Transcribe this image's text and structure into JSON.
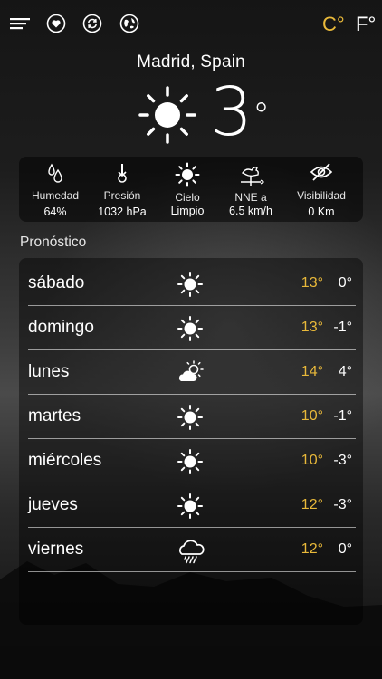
{
  "topbar": {
    "icons": [
      "menu-icon",
      "favorites-icon",
      "refresh-icon",
      "globe-icon"
    ],
    "units": {
      "celsius": "C°",
      "fahrenheit": "F°",
      "active": "celsius"
    },
    "accent_color": "#e9b93a"
  },
  "current": {
    "city": "Madrid, Spain",
    "temperature": "3",
    "degree_symbol": "°",
    "condition_icon": "sun-icon"
  },
  "stats": [
    {
      "icon": "humidity-icon",
      "label": "Humedad",
      "value": "64%"
    },
    {
      "icon": "pressure-icon",
      "label": "Presión",
      "value": "1032 hPa"
    },
    {
      "icon": "sun-icon",
      "label": "Cielo",
      "value": "Limpio"
    },
    {
      "icon": "wind-vane-icon",
      "label": "NNE a",
      "value": "6.5 km/h"
    },
    {
      "icon": "visibility-off-icon",
      "label": "Visibilidad",
      "value": "0 Km"
    }
  ],
  "forecast": {
    "title": "Pronóstico",
    "days": [
      {
        "day": "sábado",
        "icon": "sun-icon",
        "high": "13°",
        "low": "0°"
      },
      {
        "day": "domingo",
        "icon": "sun-icon",
        "high": "13°",
        "low": "-1°"
      },
      {
        "day": "lunes",
        "icon": "partly-cloudy-icon",
        "high": "14°",
        "low": "4°"
      },
      {
        "day": "martes",
        "icon": "sun-icon",
        "high": "10°",
        "low": "-1°"
      },
      {
        "day": "miércoles",
        "icon": "sun-icon",
        "high": "10°",
        "low": "-3°"
      },
      {
        "day": "jueves",
        "icon": "sun-icon",
        "high": "12°",
        "low": "-3°"
      },
      {
        "day": "viernes",
        "icon": "rain-cloud-icon",
        "high": "12°",
        "low": "0°"
      }
    ]
  }
}
